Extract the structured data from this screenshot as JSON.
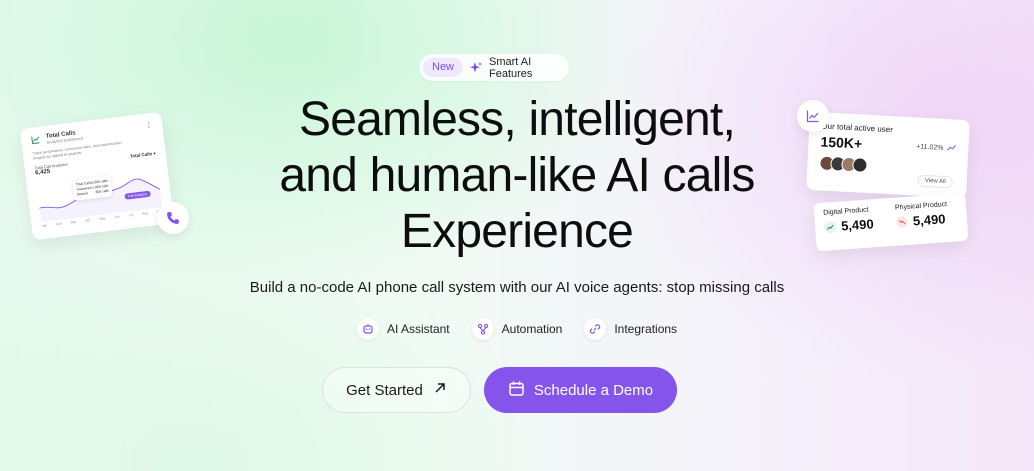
{
  "badge": {
    "new_label": "New",
    "feature_label": "Smart AI Features"
  },
  "hero": {
    "title_lines": [
      "Seamless, intelligent,",
      "and human-like AI calls",
      "Experience"
    ],
    "subtitle": "Build a no-code AI phone call system with our AI voice agents: stop missing calls"
  },
  "features": [
    {
      "label": "AI Assistant",
      "icon": "robot-icon"
    },
    {
      "label": "Automation",
      "icon": "flow-icon"
    },
    {
      "label": "Integrations",
      "icon": "link-icon"
    }
  ],
  "cta": {
    "primary_label": "Get Started",
    "secondary_label": "Schedule a Demo"
  },
  "colors": {
    "accent": "#8554ea",
    "badge_bg": "#efe9ff"
  },
  "left_card": {
    "title": "Total Calls",
    "subtitle": "Analytics Dashboard",
    "description": "Track performance, conversion rates, and customization insights for optimal AI analysis.",
    "metric_label": "Total Call Analytics",
    "metric_value": "6,425",
    "selector": "Total Calls",
    "tooltip_rows": [
      {
        "label": "Total Calls",
        "value": "2,600 calls"
      },
      {
        "label": "Answered",
        "value": "1,800 calls"
      },
      {
        "label": "Missed",
        "value": "800 calls"
      }
    ],
    "pill_label": "Full Analytics",
    "axis": [
      "Jan",
      "Feb",
      "Mar",
      "Apr",
      "May",
      "Jun",
      "Jul",
      "Aug",
      "Sep"
    ]
  },
  "right_card": {
    "label": "Our total active user",
    "value": "150K+",
    "change": "+11.02%",
    "view_all": "View All"
  },
  "products": [
    {
      "label": "Digital Product",
      "value": "5,490",
      "trend": "up"
    },
    {
      "label": "Physical Product",
      "value": "5,490",
      "trend": "down"
    }
  ]
}
